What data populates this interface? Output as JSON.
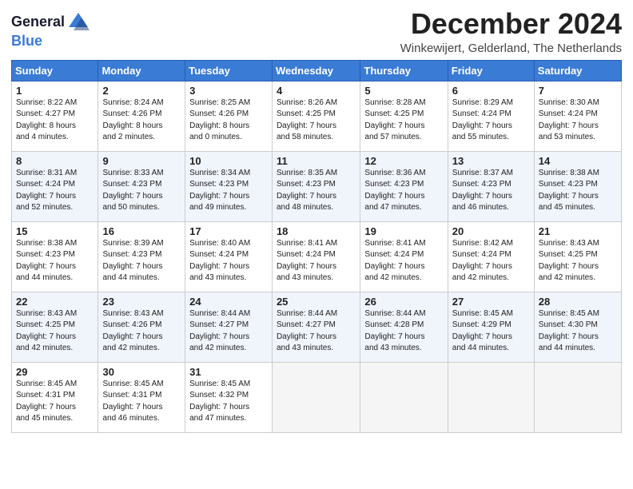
{
  "header": {
    "logo_line1": "General",
    "logo_line2": "Blue",
    "month_title": "December 2024",
    "location": "Winkewijert, Gelderland, The Netherlands"
  },
  "days_of_week": [
    "Sunday",
    "Monday",
    "Tuesday",
    "Wednesday",
    "Thursday",
    "Friday",
    "Saturday"
  ],
  "weeks": [
    [
      {
        "day": "1",
        "sunrise": "8:22 AM",
        "sunset": "4:27 PM",
        "daylight": "8 hours and 4 minutes."
      },
      {
        "day": "2",
        "sunrise": "8:24 AM",
        "sunset": "4:26 PM",
        "daylight": "8 hours and 2 minutes."
      },
      {
        "day": "3",
        "sunrise": "8:25 AM",
        "sunset": "4:26 PM",
        "daylight": "8 hours and 0 minutes."
      },
      {
        "day": "4",
        "sunrise": "8:26 AM",
        "sunset": "4:25 PM",
        "daylight": "7 hours and 58 minutes."
      },
      {
        "day": "5",
        "sunrise": "8:28 AM",
        "sunset": "4:25 PM",
        "daylight": "7 hours and 57 minutes."
      },
      {
        "day": "6",
        "sunrise": "8:29 AM",
        "sunset": "4:24 PM",
        "daylight": "7 hours and 55 minutes."
      },
      {
        "day": "7",
        "sunrise": "8:30 AM",
        "sunset": "4:24 PM",
        "daylight": "7 hours and 53 minutes."
      }
    ],
    [
      {
        "day": "8",
        "sunrise": "8:31 AM",
        "sunset": "4:24 PM",
        "daylight": "7 hours and 52 minutes."
      },
      {
        "day": "9",
        "sunrise": "8:33 AM",
        "sunset": "4:23 PM",
        "daylight": "7 hours and 50 minutes."
      },
      {
        "day": "10",
        "sunrise": "8:34 AM",
        "sunset": "4:23 PM",
        "daylight": "7 hours and 49 minutes."
      },
      {
        "day": "11",
        "sunrise": "8:35 AM",
        "sunset": "4:23 PM",
        "daylight": "7 hours and 48 minutes."
      },
      {
        "day": "12",
        "sunrise": "8:36 AM",
        "sunset": "4:23 PM",
        "daylight": "7 hours and 47 minutes."
      },
      {
        "day": "13",
        "sunrise": "8:37 AM",
        "sunset": "4:23 PM",
        "daylight": "7 hours and 46 minutes."
      },
      {
        "day": "14",
        "sunrise": "8:38 AM",
        "sunset": "4:23 PM",
        "daylight": "7 hours and 45 minutes."
      }
    ],
    [
      {
        "day": "15",
        "sunrise": "8:38 AM",
        "sunset": "4:23 PM",
        "daylight": "7 hours and 44 minutes."
      },
      {
        "day": "16",
        "sunrise": "8:39 AM",
        "sunset": "4:23 PM",
        "daylight": "7 hours and 44 minutes."
      },
      {
        "day": "17",
        "sunrise": "8:40 AM",
        "sunset": "4:24 PM",
        "daylight": "7 hours and 43 minutes."
      },
      {
        "day": "18",
        "sunrise": "8:41 AM",
        "sunset": "4:24 PM",
        "daylight": "7 hours and 43 minutes."
      },
      {
        "day": "19",
        "sunrise": "8:41 AM",
        "sunset": "4:24 PM",
        "daylight": "7 hours and 42 minutes."
      },
      {
        "day": "20",
        "sunrise": "8:42 AM",
        "sunset": "4:24 PM",
        "daylight": "7 hours and 42 minutes."
      },
      {
        "day": "21",
        "sunrise": "8:43 AM",
        "sunset": "4:25 PM",
        "daylight": "7 hours and 42 minutes."
      }
    ],
    [
      {
        "day": "22",
        "sunrise": "8:43 AM",
        "sunset": "4:25 PM",
        "daylight": "7 hours and 42 minutes."
      },
      {
        "day": "23",
        "sunrise": "8:43 AM",
        "sunset": "4:26 PM",
        "daylight": "7 hours and 42 minutes."
      },
      {
        "day": "24",
        "sunrise": "8:44 AM",
        "sunset": "4:27 PM",
        "daylight": "7 hours and 42 minutes."
      },
      {
        "day": "25",
        "sunrise": "8:44 AM",
        "sunset": "4:27 PM",
        "daylight": "7 hours and 43 minutes."
      },
      {
        "day": "26",
        "sunrise": "8:44 AM",
        "sunset": "4:28 PM",
        "daylight": "7 hours and 43 minutes."
      },
      {
        "day": "27",
        "sunrise": "8:45 AM",
        "sunset": "4:29 PM",
        "daylight": "7 hours and 44 minutes."
      },
      {
        "day": "28",
        "sunrise": "8:45 AM",
        "sunset": "4:30 PM",
        "daylight": "7 hours and 44 minutes."
      }
    ],
    [
      {
        "day": "29",
        "sunrise": "8:45 AM",
        "sunset": "4:31 PM",
        "daylight": "7 hours and 45 minutes."
      },
      {
        "day": "30",
        "sunrise": "8:45 AM",
        "sunset": "4:31 PM",
        "daylight": "7 hours and 46 minutes."
      },
      {
        "day": "31",
        "sunrise": "8:45 AM",
        "sunset": "4:32 PM",
        "daylight": "7 hours and 47 minutes."
      },
      null,
      null,
      null,
      null
    ]
  ],
  "labels": {
    "sunrise": "Sunrise:",
    "sunset": "Sunset:",
    "daylight": "Daylight:"
  }
}
